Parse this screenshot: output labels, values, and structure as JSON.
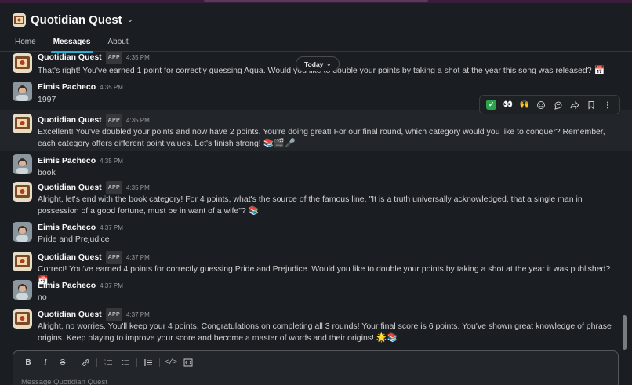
{
  "header": {
    "app_title": "Quotidian Quest",
    "tabs": [
      {
        "label": "Home"
      },
      {
        "label": "Messages"
      },
      {
        "label": "About"
      }
    ]
  },
  "day_divider": "Today",
  "messages": [
    {
      "sender": "Quotidian Quest",
      "badge": "APP",
      "time": "4:35 PM",
      "text": "That's right! You've earned 1 point for correctly guessing Aqua. Would you like to double your points by taking a shot at the year this song was released?",
      "emoji": "📅"
    },
    {
      "sender": "Eimis Pacheco",
      "time": "4:35 PM",
      "text": "1997"
    },
    {
      "sender": "Quotidian Quest",
      "badge": "APP",
      "time": "4:35 PM",
      "text": "Excellent! You've doubled your points and now have 2 points. You're doing great! For our final round, which category would you like to conquer? Remember, each category offers different point values. Let's finish strong!",
      "emoji": "📚🎬🎤"
    },
    {
      "sender": "Eimis Pacheco",
      "time": "4:35 PM",
      "text": "book"
    },
    {
      "sender": "Quotidian Quest",
      "badge": "APP",
      "time": "4:35 PM",
      "text": "Alright, let's end with the book category! For 4 points, what's the source of the famous line, \"It is a truth universally acknowledged, that a single man in possession of a good fortune, must be in want of a wife\"?",
      "emoji": "📚"
    },
    {
      "sender": "Eimis Pacheco",
      "time": "4:37 PM",
      "text": "Pride and Prejudice"
    },
    {
      "sender": "Quotidian Quest",
      "badge": "APP",
      "time": "4:37 PM",
      "text": "Correct! You've earned 4 points for correctly guessing Pride and Prejudice. Would you like to double your points by taking a shot at the year it was published?",
      "emoji": "📅"
    },
    {
      "sender": "Eimis Pacheco",
      "time": "4:37 PM",
      "text": "no"
    },
    {
      "sender": "Quotidian Quest",
      "badge": "APP",
      "time": "4:37 PM",
      "text": "Alright, no worries. You'll keep your 4 points. Congratulations on completing all 3 rounds! Your final score is 6 points. You've shown great knowledge of phrase origins. Keep playing to improve your score and become a master of words and their origins!",
      "emoji": "🌟📚"
    }
  ],
  "hover_toolbar": {
    "icons": [
      "check-reaction-icon",
      "eyes-reaction-icon",
      "raised-hands-reaction-icon",
      "add-reaction-icon",
      "reply-in-thread-icon",
      "forward-icon",
      "bookmark-icon",
      "more-actions-icon"
    ]
  },
  "composer": {
    "placeholder": "Message Quotidian Quest",
    "format_buttons": [
      "bold-icon",
      "italic-icon",
      "strikethrough-icon",
      "link-icon",
      "ordered-list-icon",
      "bulleted-list-icon",
      "blockquote-icon",
      "code-icon",
      "code-block-icon"
    ]
  }
}
